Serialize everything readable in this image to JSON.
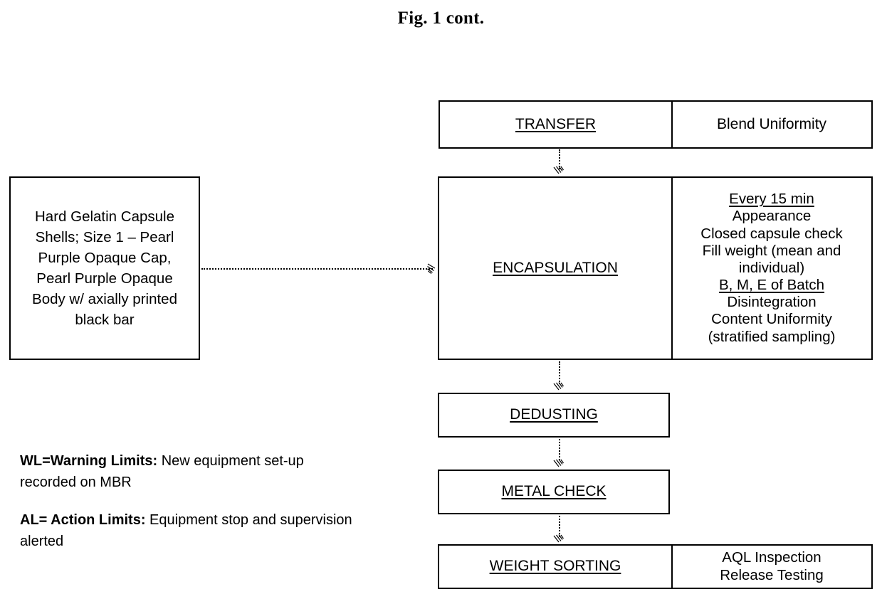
{
  "figure": {
    "title": "Fig. 1 cont."
  },
  "flow": {
    "transfer": {
      "step_label": "TRANSFER",
      "tests": "Blend Uniformity"
    },
    "encapsulation": {
      "step_label": "ENCAPSULATION",
      "tests_heading_1": "Every 15 min",
      "tests_1": [
        "Appearance",
        "Closed capsule check",
        "Fill weight (mean and",
        "individual)"
      ],
      "tests_heading_2": "B, M, E of Batch",
      "tests_2": [
        "Disintegration",
        "Content Uniformity",
        "(stratified sampling)"
      ]
    },
    "dedusting": {
      "step_label": "DEDUSTING"
    },
    "metal_check": {
      "step_label": "METAL CHECK"
    },
    "weight_sorting": {
      "step_label": "WEIGHT SORTING",
      "tests": [
        "AQL Inspection",
        "Release Testing"
      ]
    }
  },
  "inputs": {
    "capsule_shells": [
      "Hard Gelatin Capsule",
      "Shells;  Size 1 – Pearl",
      "Purple Opaque Cap,",
      "Pearl Purple Opaque",
      "Body w/ axially printed",
      "black bar"
    ]
  },
  "legend": {
    "warning": {
      "term": "WL=Warning Limits:",
      "definition": " New equipment set-up recorded on MBR"
    },
    "action": {
      "term": "AL= Action Limits:",
      "definition": " Equipment stop and supervision alerted"
    }
  },
  "style": {
    "line_color": "#000000",
    "background": "#ffffff"
  }
}
